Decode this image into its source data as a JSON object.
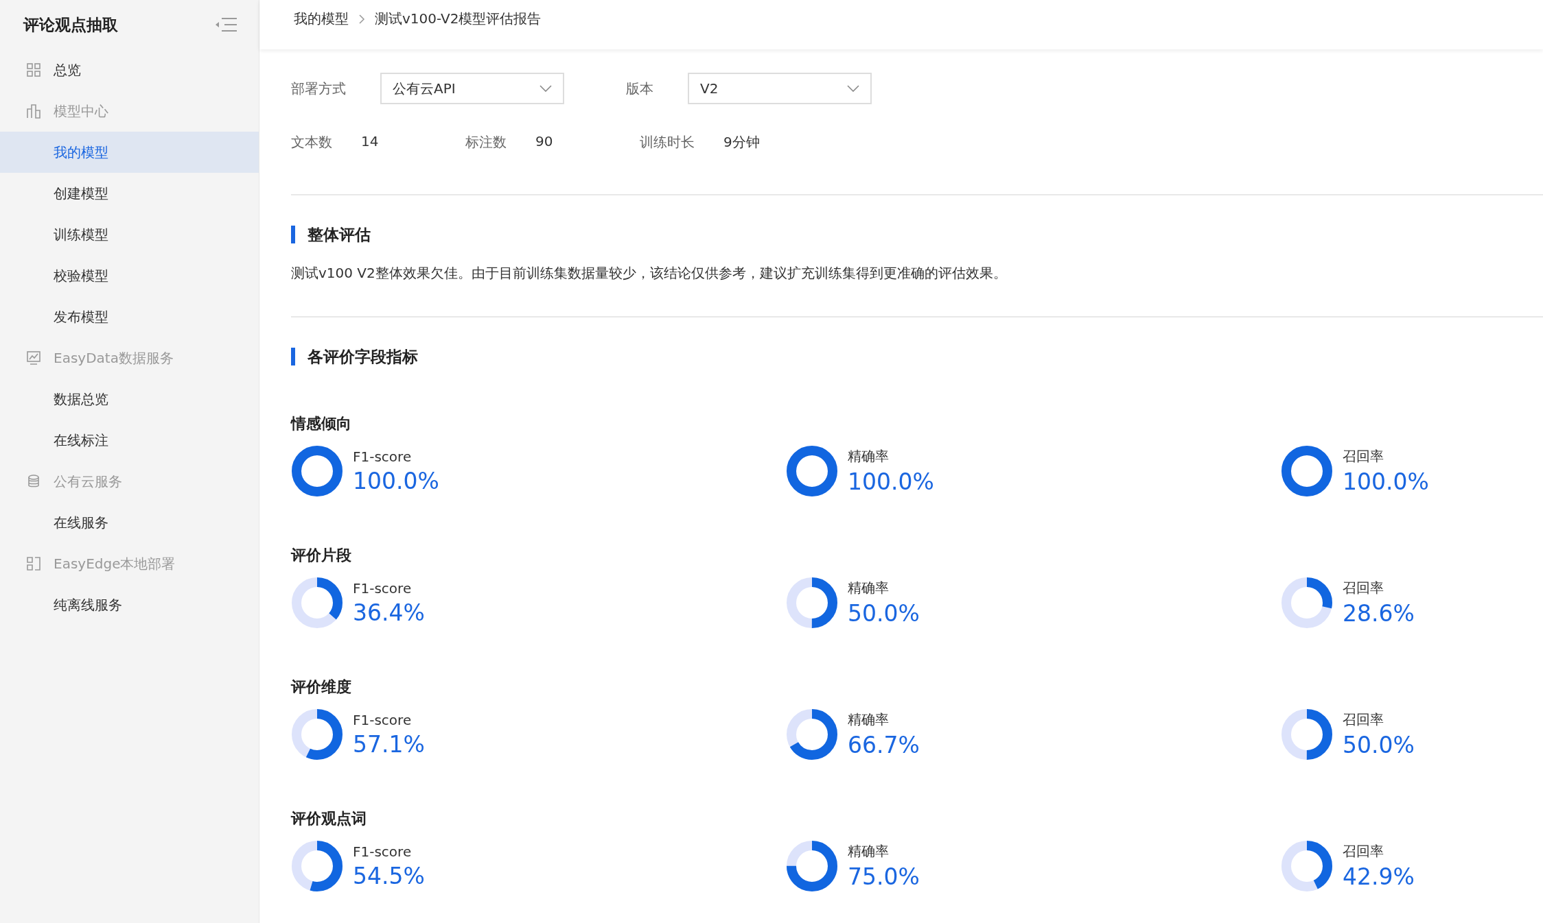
{
  "sidebar": {
    "title": "评论观点抽取",
    "items": [
      {
        "label": "总览",
        "kind": "link",
        "selected": false
      },
      {
        "label": "模型中心",
        "kind": "group",
        "selected": false
      },
      {
        "label": "我的模型",
        "kind": "sub",
        "selected": true
      },
      {
        "label": "创建模型",
        "kind": "sub",
        "selected": false
      },
      {
        "label": "训练模型",
        "kind": "sub",
        "selected": false
      },
      {
        "label": "校验模型",
        "kind": "sub",
        "selected": false
      },
      {
        "label": "发布模型",
        "kind": "sub",
        "selected": false
      },
      {
        "label": "EasyData数据服务",
        "kind": "group",
        "selected": false
      },
      {
        "label": "数据总览",
        "kind": "sub",
        "selected": false
      },
      {
        "label": "在线标注",
        "kind": "sub",
        "selected": false
      },
      {
        "label": "公有云服务",
        "kind": "group",
        "selected": false
      },
      {
        "label": "在线服务",
        "kind": "sub",
        "selected": false
      },
      {
        "label": "EasyEdge本地部署",
        "kind": "group",
        "selected": false
      },
      {
        "label": "纯离线服务",
        "kind": "sub",
        "selected": false
      }
    ]
  },
  "breadcrumb": [
    "我的模型",
    "测试v100-V2模型评估报告"
  ],
  "filters": [
    {
      "label": "部署方式",
      "value": "公有云API"
    },
    {
      "label": "版本",
      "value": "V2"
    }
  ],
  "stats": [
    {
      "label": "文本数",
      "value": "14"
    },
    {
      "label": "标注数",
      "value": "90"
    },
    {
      "label": "训练时长",
      "value": "9分钟"
    }
  ],
  "overall": {
    "title": "整体评估",
    "text": "测试v100 V2整体效果欠佳。由于目前训练集数据量较少，该结论仅供参考，建议扩充训练集得到更准确的评估效果。"
  },
  "metrics_section": {
    "title": "各评价字段指标",
    "groups": [
      {
        "name": "情感倾向",
        "metrics": [
          {
            "label": "F1-score",
            "value": "100.0%",
            "level": 1.0
          },
          {
            "label": "精确率",
            "value": "100.0%",
            "level": 1.0
          },
          {
            "label": "召回率",
            "value": "100.0%",
            "level": 1.0
          }
        ]
      },
      {
        "name": "评价片段",
        "metrics": [
          {
            "label": "F1-score",
            "value": "36.4%",
            "level": 0.364
          },
          {
            "label": "精确率",
            "value": "50.0%",
            "level": 0.5
          },
          {
            "label": "召回率",
            "value": "28.6%",
            "level": 0.286
          }
        ]
      },
      {
        "name": "评价维度",
        "metrics": [
          {
            "label": "F1-score",
            "value": "57.1%",
            "level": 0.571
          },
          {
            "label": "精确率",
            "value": "66.7%",
            "level": 0.667
          },
          {
            "label": "召回率",
            "value": "50.0%",
            "level": 0.5
          }
        ]
      },
      {
        "name": "评价观点词",
        "metrics": [
          {
            "label": "F1-score",
            "value": "54.5%",
            "level": 0.545
          },
          {
            "label": "精确率",
            "value": "75.0%",
            "level": 0.75
          },
          {
            "label": "召回率",
            "value": "42.9%",
            "level": 0.429
          }
        ]
      }
    ]
  }
}
